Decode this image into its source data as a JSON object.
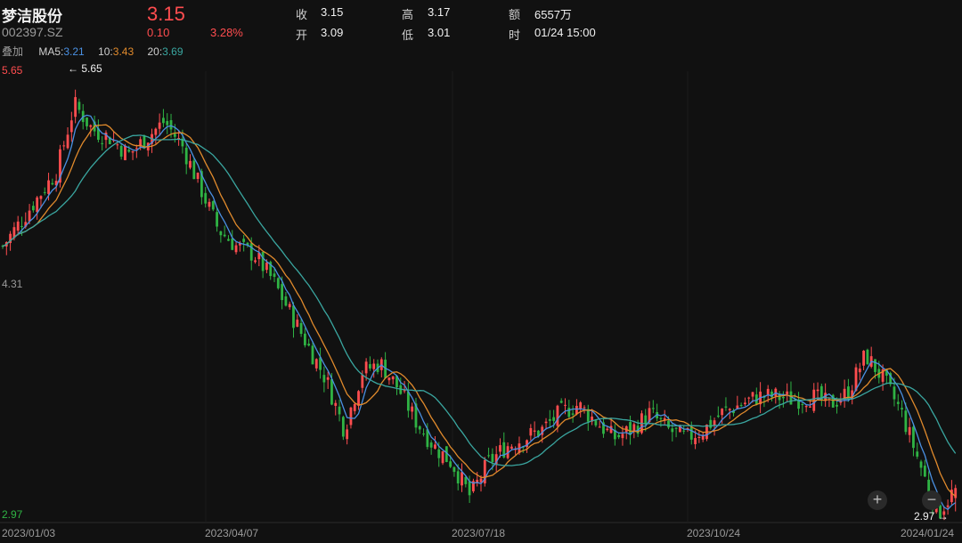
{
  "header": {
    "stock_name": "梦洁股份",
    "stock_code": "002397.SZ",
    "price": "3.15",
    "change": "0.10",
    "change_pct": "3.28%",
    "stats": {
      "close_label": "收",
      "close_value": "3.15",
      "open_label": "开",
      "open_value": "3.09",
      "high_label": "高",
      "high_value": "3.17",
      "low_label": "低",
      "low_value": "3.01",
      "amount_label": "额",
      "amount_value": "6557万",
      "time_label": "时",
      "time_value": "01/24 15:00"
    },
    "ma": {
      "overlay_label": "叠加",
      "ma5_label": "MA5:",
      "ma5_value": "3.21",
      "ma10_label": "10:",
      "ma10_value": "3.43",
      "ma20_label": "20:",
      "ma20_value": "3.69"
    }
  },
  "colors": {
    "up": "#ff4d4f",
    "down": "#2fb344",
    "ma5": "#4a90e2",
    "ma10": "#e08a2c",
    "ma20": "#3aa6a0",
    "background": "#111111"
  },
  "chart_data": {
    "type": "candlestick",
    "y_axis_labels": [
      "5.65",
      "4.31",
      "2.97"
    ],
    "x_axis_labels": [
      "2023/01/03",
      "2023/04/07",
      "2023/07/18",
      "2023/10/24",
      "2024/01/24"
    ],
    "ylim": [
      2.97,
      5.65
    ],
    "max_marker": "5.65",
    "min_marker": "2.97",
    "close_path": [
      [
        "2023/01/03",
        4.6
      ],
      [
        "2023/01/10",
        4.75
      ],
      [
        "2023/01/17",
        4.9
      ],
      [
        "2023/01/31",
        5.05
      ],
      [
        "2023/02/07",
        5.45
      ],
      [
        "2023/02/14",
        5.3
      ],
      [
        "2023/02/21",
        5.25
      ],
      [
        "2023/02/28",
        5.15
      ],
      [
        "2023/03/07",
        5.25
      ],
      [
        "2023/03/14",
        5.35
      ],
      [
        "2023/03/21",
        5.2
      ],
      [
        "2023/03/28",
        4.95
      ],
      [
        "2023/04/07",
        4.7
      ],
      [
        "2023/04/14",
        4.6
      ],
      [
        "2023/04/21",
        4.55
      ],
      [
        "2023/04/28",
        4.4
      ],
      [
        "2023/05/08",
        4.2
      ],
      [
        "2023/05/15",
        4.0
      ],
      [
        "2023/05/22",
        3.8
      ],
      [
        "2023/05/29",
        3.5
      ],
      [
        "2023/06/05",
        3.85
      ],
      [
        "2023/06/12",
        3.9
      ],
      [
        "2023/06/19",
        3.75
      ],
      [
        "2023/06/26",
        3.55
      ],
      [
        "2023/07/03",
        3.4
      ],
      [
        "2023/07/10",
        3.3
      ],
      [
        "2023/07/18",
        3.1
      ],
      [
        "2023/07/25",
        3.3
      ],
      [
        "2023/08/01",
        3.4
      ],
      [
        "2023/08/08",
        3.45
      ],
      [
        "2023/08/15",
        3.5
      ],
      [
        "2023/08/22",
        3.6
      ],
      [
        "2023/08/29",
        3.65
      ],
      [
        "2023/09/05",
        3.55
      ],
      [
        "2023/09/12",
        3.45
      ],
      [
        "2023/09/19",
        3.5
      ],
      [
        "2023/09/26",
        3.6
      ],
      [
        "2023/10/10",
        3.5
      ],
      [
        "2023/10/17",
        3.45
      ],
      [
        "2023/10/24",
        3.5
      ],
      [
        "2023/10/31",
        3.6
      ],
      [
        "2023/11/07",
        3.65
      ],
      [
        "2023/11/14",
        3.7
      ],
      [
        "2023/11/21",
        3.7
      ],
      [
        "2023/11/28",
        3.68
      ],
      [
        "2023/12/05",
        3.7
      ],
      [
        "2023/12/12",
        3.65
      ],
      [
        "2023/12/19",
        3.72
      ],
      [
        "2023/12/26",
        3.95
      ],
      [
        "2024/01/02",
        3.8
      ],
      [
        "2024/01/09",
        3.6
      ],
      [
        "2024/01/16",
        3.3
      ],
      [
        "2024/01/23",
        2.99
      ],
      [
        "2024/01/24",
        3.15
      ]
    ],
    "series": [
      {
        "name": "MA5",
        "value": 3.21
      },
      {
        "name": "10",
        "value": 3.43
      },
      {
        "name": "20",
        "value": 3.69
      }
    ]
  }
}
